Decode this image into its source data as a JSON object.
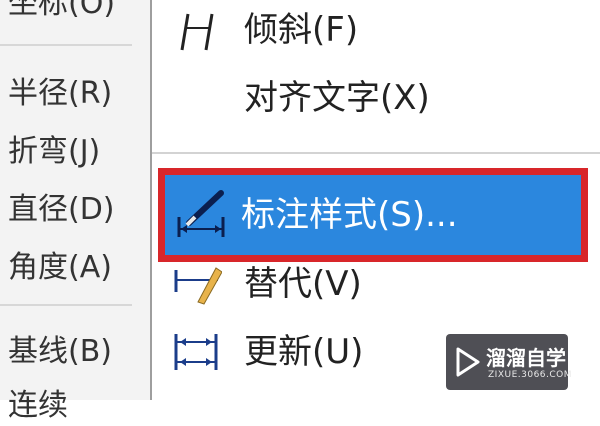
{
  "left_menu": {
    "items": [
      {
        "label": "坐标(O)"
      },
      {
        "label": "半径(R)"
      },
      {
        "label": "折弯(J)"
      },
      {
        "label": "直径(D)"
      },
      {
        "label": "角度(A)"
      },
      {
        "label": "基线(B)"
      },
      {
        "label": "连续"
      }
    ]
  },
  "right_menu": {
    "items": [
      {
        "label": "倾斜(F)",
        "icon": "oblique-icon"
      },
      {
        "label": "对齐文字(X)",
        "icon": ""
      },
      {
        "label": "标注样式(S)...",
        "icon": "dimension-style-icon",
        "selected": true
      },
      {
        "label": "替代(V)",
        "icon": "override-icon"
      },
      {
        "label": "更新(U)",
        "icon": "update-icon"
      }
    ]
  },
  "highlight_color": "#2b87de",
  "annotation_border_color": "#d8262a",
  "watermark": {
    "title": "溜溜自学",
    "subtitle": "ZIXUE.3066.COM"
  }
}
